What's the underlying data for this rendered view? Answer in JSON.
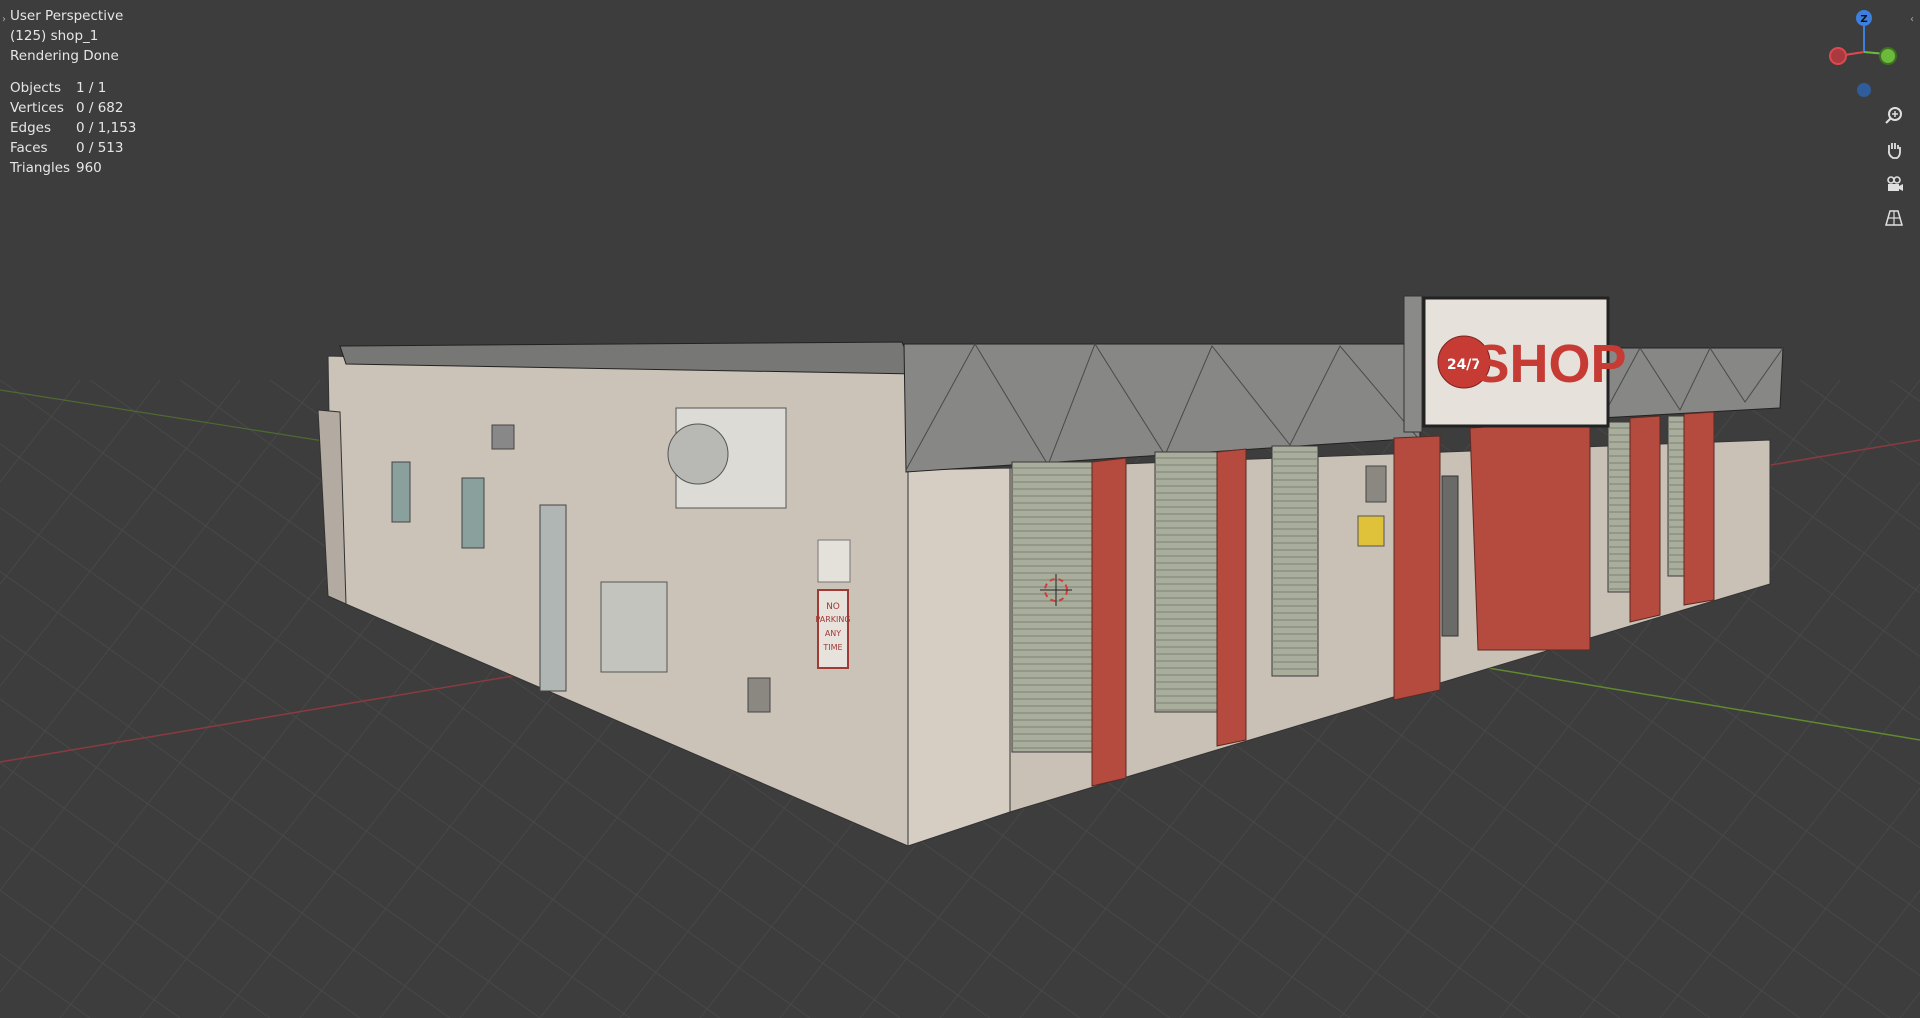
{
  "viewport": {
    "view_name": "User Perspective",
    "object_label": "(125) shop_1",
    "status": "Rendering Done",
    "stats": [
      {
        "label": "Objects",
        "value": "1 / 1"
      },
      {
        "label": "Vertices",
        "value": "0 / 682"
      },
      {
        "label": "Edges",
        "value": "0 / 1,153"
      },
      {
        "label": "Faces",
        "value": "0 / 513"
      },
      {
        "label": "Triangles",
        "value": "960"
      }
    ]
  },
  "gizmo": {
    "z_label": "Z",
    "colors": {
      "x": "#e0484f",
      "y": "#6cba3b",
      "z": "#3d7fe0"
    }
  },
  "nav_buttons": [
    {
      "name": "zoom-icon"
    },
    {
      "name": "pan-hand-icon"
    },
    {
      "name": "camera-view-icon"
    },
    {
      "name": "perspective-grid-icon"
    }
  ],
  "scene": {
    "sign_text": "SHOP",
    "sign_badge": "24/7",
    "no_parking_text": [
      "NO",
      "PARKING",
      "ANY",
      "TIME"
    ],
    "colors": {
      "background": "#3d3d3d",
      "grid": "#484848",
      "x_axis": "#8a3a40",
      "y_axis": "#5f8a2e",
      "wall": "#cfc5bb",
      "wall_dark": "#b8afa5",
      "roof": "#7a7a78",
      "pillar": "#b54a3e",
      "shutter": "#a9ae9c",
      "sign_red": "#c73b35"
    }
  }
}
